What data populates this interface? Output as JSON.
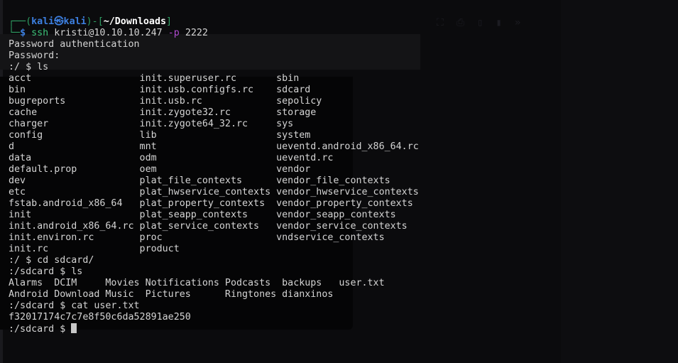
{
  "prompt": {
    "user": "kali",
    "host": "kali",
    "at": "㉿",
    "path": "~/Downloads",
    "command": "ssh",
    "args": "kristi@10.10.10.247",
    "flag": "-p",
    "port": "2222"
  },
  "lines_before_ls": [
    "Password authentication",
    "Password:",
    ":/ $ ls"
  ],
  "ls_root": [
    "acct                   init.superuser.rc       sbin",
    "bin                    init.usb.configfs.rc    sdcard",
    "bugreports             init.usb.rc             sepolicy",
    "cache                  init.zygote32.rc        storage",
    "charger                init.zygote64_32.rc     sys",
    "config                 lib                     system",
    "d                      mnt                     ueventd.android_x86_64.rc",
    "data                   odm                     ueventd.rc",
    "default.prop           oem                     vendor",
    "dev                    plat_file_contexts      vendor_file_contexts",
    "etc                    plat_hwservice_contexts vendor_hwservice_contexts",
    "fstab.android_x86_64   plat_property_contexts  vendor_property_contexts",
    "init                   plat_seapp_contexts     vendor_seapp_contexts",
    "init.android_x86_64.rc plat_service_contexts   vendor_service_contexts",
    "init.environ.rc        proc                    vndservice_contexts",
    "init.rc                product"
  ],
  "after": [
    ":/ $ cd sdcard/",
    ":/sdcard $ ls",
    "Alarms  DCIM     Movies Notifications Podcasts  backups   user.txt",
    "Android Download Music  Pictures      Ringtones dianxinos",
    ":/sdcard $ cat user.txt",
    "f32017174c7c7e8f50c6da52891ae250"
  ],
  "final_prompt": ":/sdcard $ ",
  "colors": {
    "prompt_frame": "#2f9e63",
    "user": "#3c7fe0",
    "command": "#3ec37a",
    "flag": "#b04bd0",
    "background": "#0b0b0d",
    "text": "#d4d4d4"
  }
}
